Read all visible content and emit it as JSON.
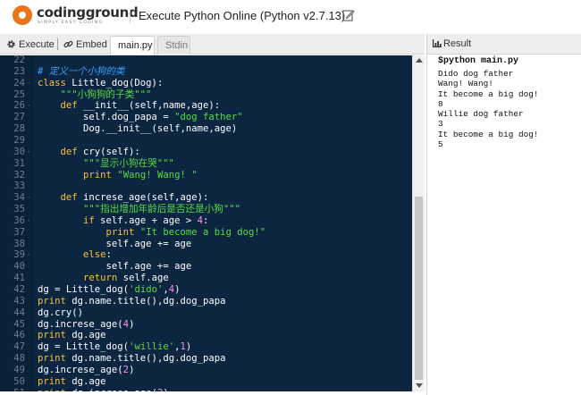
{
  "header": {
    "logo_name": "codingground",
    "logo_tagline": "SIMPLY EASY CODING",
    "title": "Execute Python Online (Python v2.7.13)"
  },
  "toolbar": {
    "execute_label": "Execute",
    "embed_label": "Embed",
    "tabs": [
      {
        "label": "main.py",
        "active": true
      },
      {
        "label": "Stdin",
        "active": false
      }
    ]
  },
  "editor": {
    "lines": [
      {
        "n": "22",
        "fold": "",
        "tokens": [
          {
            "t": "",
            "c": "t"
          }
        ]
      },
      {
        "n": "23",
        "fold": "",
        "tokens": [
          {
            "t": "# 定义一个小狗的类",
            "c": "cm"
          }
        ]
      },
      {
        "n": "24",
        "fold": "-",
        "tokens": [
          {
            "t": "class",
            "c": "kw"
          },
          {
            "t": " Little_dog(Dog):",
            "c": "t"
          }
        ]
      },
      {
        "n": "25",
        "fold": "",
        "tokens": [
          {
            "t": "    ",
            "c": "t"
          },
          {
            "t": "\"\"\"小狗狗的子类\"\"\"",
            "c": "str"
          }
        ]
      },
      {
        "n": "26",
        "fold": "-",
        "tokens": [
          {
            "t": "    ",
            "c": "t"
          },
          {
            "t": "def",
            "c": "kw"
          },
          {
            "t": " __init__(self,name,age):",
            "c": "t"
          }
        ]
      },
      {
        "n": "27",
        "fold": "",
        "tokens": [
          {
            "t": "        self.dog_papa = ",
            "c": "t"
          },
          {
            "t": "\"dog father\"",
            "c": "str"
          }
        ]
      },
      {
        "n": "28",
        "fold": "",
        "tokens": [
          {
            "t": "        Dog.__init__(self,name,age)",
            "c": "t"
          }
        ]
      },
      {
        "n": "29",
        "fold": "",
        "tokens": [
          {
            "t": "",
            "c": "t"
          }
        ]
      },
      {
        "n": "30",
        "fold": "-",
        "tokens": [
          {
            "t": "    ",
            "c": "t"
          },
          {
            "t": "def",
            "c": "kw"
          },
          {
            "t": " cry(self):",
            "c": "t"
          }
        ]
      },
      {
        "n": "31",
        "fold": "",
        "tokens": [
          {
            "t": "        ",
            "c": "t"
          },
          {
            "t": "\"\"\"显示小狗在哭\"\"\"",
            "c": "str"
          }
        ]
      },
      {
        "n": "32",
        "fold": "",
        "tokens": [
          {
            "t": "        ",
            "c": "t"
          },
          {
            "t": "print",
            "c": "kw"
          },
          {
            "t": " ",
            "c": "t"
          },
          {
            "t": "\"Wang! Wang! \"",
            "c": "str"
          }
        ]
      },
      {
        "n": "33",
        "fold": "",
        "tokens": [
          {
            "t": "",
            "c": "t"
          }
        ]
      },
      {
        "n": "34",
        "fold": "-",
        "tokens": [
          {
            "t": "    ",
            "c": "t"
          },
          {
            "t": "def",
            "c": "kw"
          },
          {
            "t": " increse_age(self,age):",
            "c": "t"
          }
        ]
      },
      {
        "n": "35",
        "fold": "",
        "tokens": [
          {
            "t": "        ",
            "c": "t"
          },
          {
            "t": "\"\"\"指出增加年龄后是否还是小狗\"\"\"",
            "c": "str"
          }
        ]
      },
      {
        "n": "36",
        "fold": "-",
        "tokens": [
          {
            "t": "        ",
            "c": "t"
          },
          {
            "t": "if",
            "c": "kw"
          },
          {
            "t": " self.age + age > ",
            "c": "t"
          },
          {
            "t": "4",
            "c": "num"
          },
          {
            "t": ":",
            "c": "t"
          }
        ]
      },
      {
        "n": "37",
        "fold": "",
        "tokens": [
          {
            "t": "            ",
            "c": "t"
          },
          {
            "t": "print",
            "c": "kw"
          },
          {
            "t": " ",
            "c": "t"
          },
          {
            "t": "\"It become a big dog!\"",
            "c": "str"
          }
        ]
      },
      {
        "n": "38",
        "fold": "",
        "tokens": [
          {
            "t": "            self.age += age",
            "c": "t"
          }
        ]
      },
      {
        "n": "39",
        "fold": "-",
        "tokens": [
          {
            "t": "        ",
            "c": "t"
          },
          {
            "t": "else",
            "c": "kw"
          },
          {
            "t": ":",
            "c": "t"
          }
        ]
      },
      {
        "n": "40",
        "fold": "",
        "tokens": [
          {
            "t": "            self.age += age",
            "c": "t"
          }
        ]
      },
      {
        "n": "41",
        "fold": "",
        "tokens": [
          {
            "t": "        ",
            "c": "t"
          },
          {
            "t": "return",
            "c": "kw"
          },
          {
            "t": " self.age",
            "c": "t"
          }
        ]
      },
      {
        "n": "42",
        "fold": "",
        "tokens": [
          {
            "t": "dg = Little_dog(",
            "c": "t"
          },
          {
            "t": "'dido'",
            "c": "str"
          },
          {
            "t": ",",
            "c": "t"
          },
          {
            "t": "4",
            "c": "num"
          },
          {
            "t": ")",
            "c": "t"
          }
        ]
      },
      {
        "n": "43",
        "fold": "",
        "tokens": [
          {
            "t": "print",
            "c": "kw"
          },
          {
            "t": " dg.name.title(),dg.dog_papa",
            "c": "t"
          }
        ]
      },
      {
        "n": "44",
        "fold": "",
        "tokens": [
          {
            "t": "dg.cry()",
            "c": "t"
          }
        ]
      },
      {
        "n": "45",
        "fold": "",
        "tokens": [
          {
            "t": "dg.increse_age(",
            "c": "t"
          },
          {
            "t": "4",
            "c": "num"
          },
          {
            "t": ")",
            "c": "t"
          }
        ]
      },
      {
        "n": "46",
        "fold": "",
        "tokens": [
          {
            "t": "print",
            "c": "kw"
          },
          {
            "t": " dg.age",
            "c": "t"
          }
        ]
      },
      {
        "n": "47",
        "fold": "",
        "tokens": [
          {
            "t": "dg = Little_dog(",
            "c": "t"
          },
          {
            "t": "'willie'",
            "c": "str"
          },
          {
            "t": ",",
            "c": "t"
          },
          {
            "t": "1",
            "c": "num"
          },
          {
            "t": ")",
            "c": "t"
          }
        ]
      },
      {
        "n": "48",
        "fold": "",
        "tokens": [
          {
            "t": "print",
            "c": "kw"
          },
          {
            "t": " dg.name.title(),dg.dog_papa",
            "c": "t"
          }
        ]
      },
      {
        "n": "49",
        "fold": "",
        "tokens": [
          {
            "t": "dg.increse_age(",
            "c": "t"
          },
          {
            "t": "2",
            "c": "num"
          },
          {
            "t": ")",
            "c": "t"
          }
        ]
      },
      {
        "n": "50",
        "fold": "",
        "tokens": [
          {
            "t": "print",
            "c": "kw"
          },
          {
            "t": " dg.age",
            "c": "t"
          }
        ]
      },
      {
        "n": "51",
        "fold": "",
        "tokens": [
          {
            "t": "print",
            "c": "kw"
          },
          {
            "t": " dg.increse_age(",
            "c": "t"
          },
          {
            "t": "2",
            "c": "num"
          },
          {
            "t": ")",
            "c": "t"
          }
        ]
      }
    ]
  },
  "result": {
    "title": "Result",
    "command": "$python main.py",
    "output": [
      "Dido dog father",
      "Wang! Wang!",
      "It become a big dog!",
      "8",
      "Willie dog father",
      "3",
      "It become a big dog!",
      "5"
    ]
  },
  "colors": {
    "editor_bg": "#0c2541",
    "keyword": "#f7c13d",
    "string": "#55dd44",
    "comment": "#3aa3ff",
    "number": "#ff8ce8",
    "logo_accent": "#e8751a"
  }
}
